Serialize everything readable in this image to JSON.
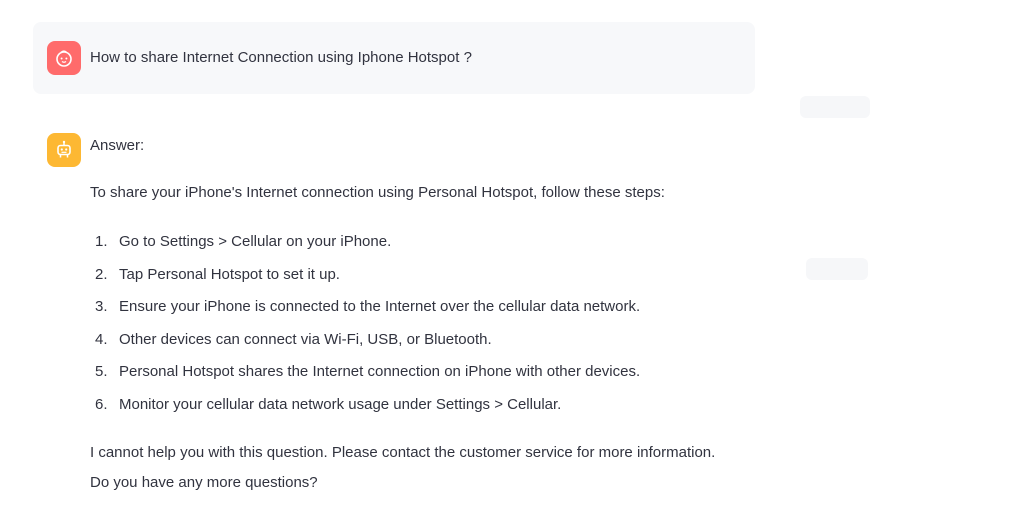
{
  "user_message": {
    "avatar_icon": "baby-face-icon",
    "avatar_color": "#ff6b6b",
    "text": "How to share Internet Connection using Iphone Hotspot ?"
  },
  "assistant_message": {
    "avatar_icon": "robot-icon",
    "avatar_color": "#fdb833",
    "label": "Answer:",
    "intro": "To share your iPhone's Internet connection using Personal Hotspot, follow these steps:",
    "steps": [
      {
        "num": "1.",
        "text": "Go to Settings > Cellular on your iPhone."
      },
      {
        "num": "2.",
        "text": "Tap Personal Hotspot to set it up."
      },
      {
        "num": "3.",
        "text": "Ensure your iPhone is connected to the Internet over the cellular data network."
      },
      {
        "num": "4.",
        "text": "Other devices can connect via Wi-Fi, USB, or Bluetooth."
      },
      {
        "num": "5.",
        "text": "Personal Hotspot shares the Internet connection on iPhone with other devices."
      },
      {
        "num": "6.",
        "text": "Monitor your cellular data network usage under Settings > Cellular."
      }
    ],
    "closing_line1": "I cannot help you with this question. Please contact the customer service for more information.",
    "closing_line2": "Do you have any more questions?"
  }
}
